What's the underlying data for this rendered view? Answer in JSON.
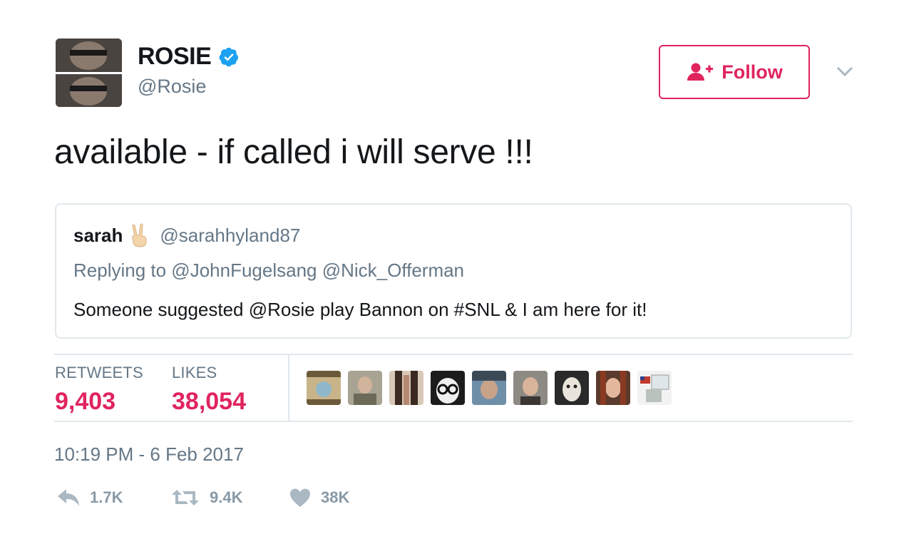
{
  "author": {
    "display_name": "ROSIE",
    "handle": "@Rosie",
    "verified": true
  },
  "follow_button": {
    "label": "Follow"
  },
  "tweet": {
    "text": "available - if called i will serve !!!"
  },
  "quoted_tweet": {
    "name": "sarah",
    "name_emoji": "peace-hand-icon",
    "handle": "@sarahhyland87",
    "replying_to": "Replying to @JohnFugelsang @Nick_Offerman",
    "text": "Someone suggested @Rosie play Bannon on #SNL & I am here for it!"
  },
  "stats": {
    "retweets_label": "RETWEETS",
    "retweets_value": "9,403",
    "likes_label": "LIKES",
    "likes_value": "38,054"
  },
  "likers_count_shown": 9,
  "timestamp": "10:19 PM - 6 Feb 2017",
  "actions": {
    "reply_count": "1.7K",
    "retweet_count": "9.4K",
    "like_count": "38K"
  },
  "colors": {
    "accent": "#e0245e",
    "verified": "#1da1f2",
    "muted_text": "#657786",
    "action_icon": "#8899a6",
    "border": "#e1e8ed"
  }
}
